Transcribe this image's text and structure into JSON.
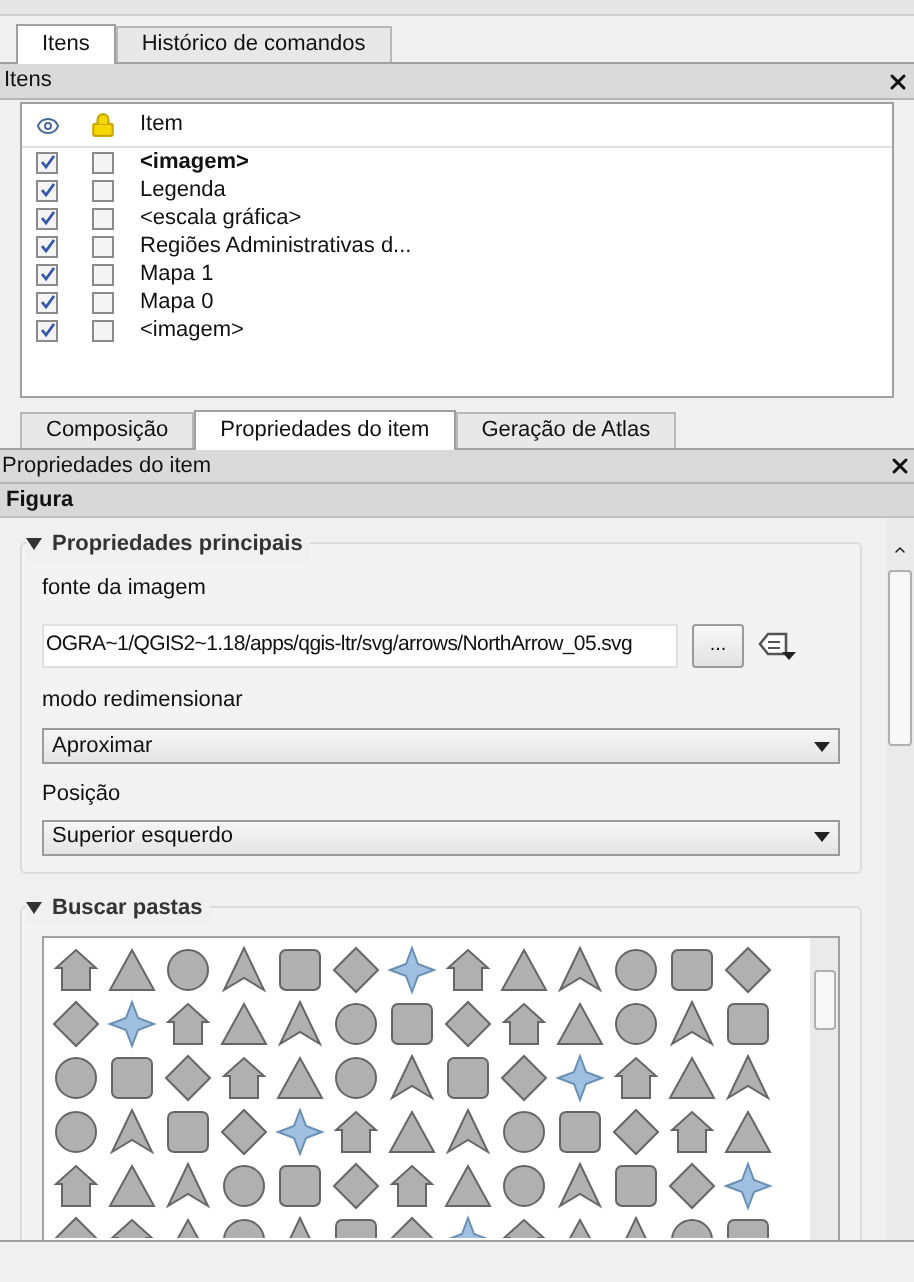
{
  "top_tabs": [
    {
      "label": "Itens",
      "selected": true
    },
    {
      "label": "Histórico de comandos",
      "selected": false
    }
  ],
  "items_panel": {
    "title": "Itens",
    "column_header": "Item",
    "rows": [
      {
        "label": "<imagem>",
        "bold": true,
        "visible": true,
        "locked": false
      },
      {
        "label": "Legenda",
        "bold": false,
        "visible": true,
        "locked": false
      },
      {
        "label": "<escala gráfica>",
        "bold": false,
        "visible": true,
        "locked": false
      },
      {
        "label": "Regiões Administrativas d...",
        "bold": false,
        "visible": true,
        "locked": false
      },
      {
        "label": "Mapa 1",
        "bold": false,
        "visible": true,
        "locked": false
      },
      {
        "label": "Mapa 0",
        "bold": false,
        "visible": true,
        "locked": false
      },
      {
        "label": "<imagem>",
        "bold": false,
        "visible": true,
        "locked": false
      }
    ]
  },
  "bottom_tabs": [
    {
      "label": "Composição",
      "selected": false
    },
    {
      "label": "Propriedades do item",
      "selected": true
    },
    {
      "label": "Geração de Atlas",
      "selected": false
    }
  ],
  "properties_panel": {
    "title": "Propriedades do item",
    "section": "Figura",
    "main_group": {
      "title": "Propriedades principais",
      "expanded": true,
      "image_source_label": "fonte da imagem",
      "image_source_value": "OGRA~1/QGIS2~1.18/apps/qgis-ltr/svg/arrows/NorthArrow_05.svg",
      "browse_button": "...",
      "resize_label": "modo redimensionar",
      "resize_value": "Aproximar",
      "position_label": "Posição",
      "position_value": "Superior esquerdo"
    },
    "folders_group": {
      "title": "Buscar pastas",
      "expanded": true
    }
  }
}
